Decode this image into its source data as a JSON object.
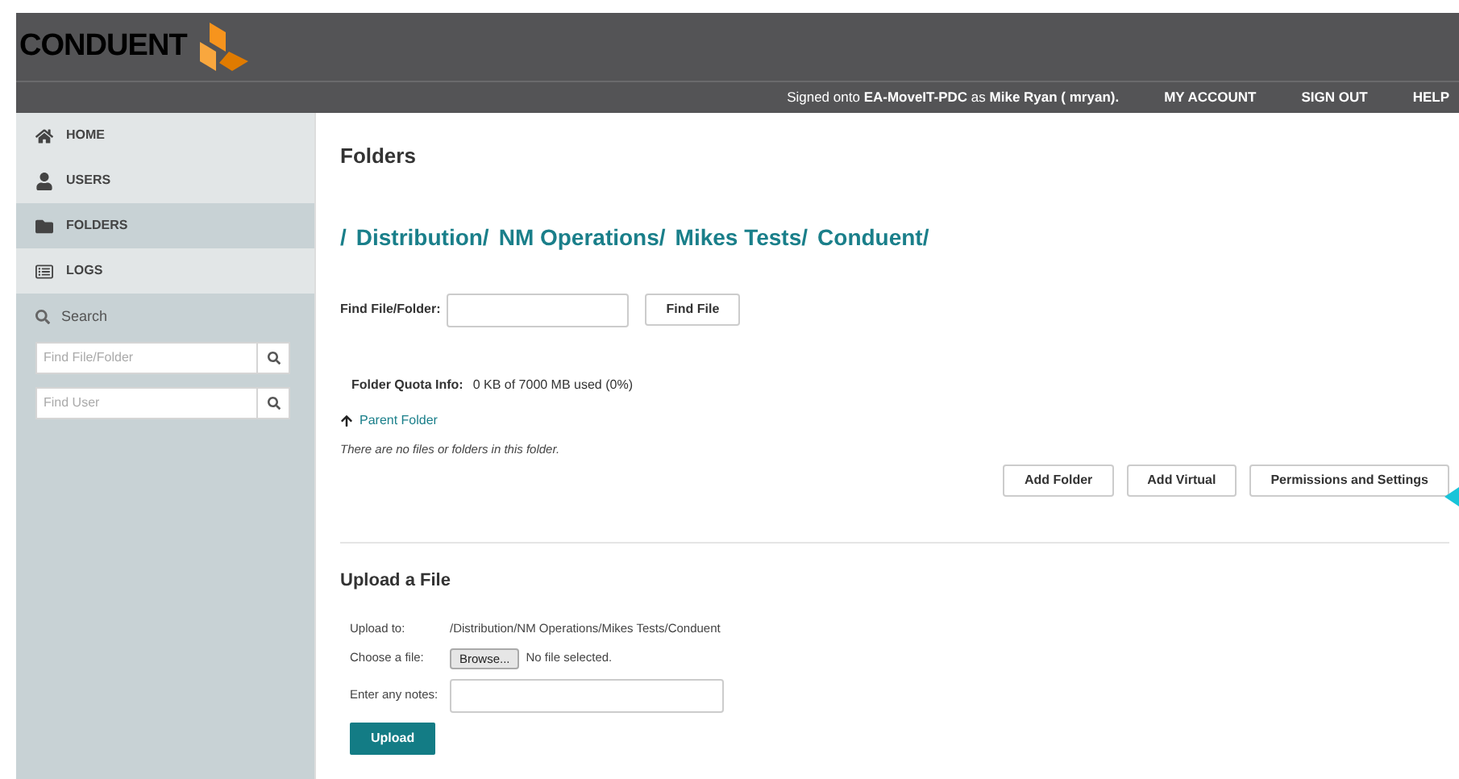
{
  "header": {
    "logo_text": "CONDUENT",
    "signed_in_prefix": "Signed onto",
    "server": "EA-MoveIT-PDC",
    "signed_in_middle": "as",
    "user": "Mike Ryan ( mryan).",
    "links": [
      "MY ACCOUNT",
      "SIGN OUT",
      "HELP"
    ]
  },
  "sidebar": {
    "items": [
      {
        "kind": "home",
        "label": "HOME",
        "selected": false
      },
      {
        "kind": "users",
        "label": "USERS",
        "selected": false
      },
      {
        "kind": "folders",
        "label": "FOLDERS",
        "selected": true
      },
      {
        "kind": "logs",
        "label": "LOGS",
        "selected": false
      }
    ],
    "search_label": "Search",
    "search_fields": [
      {
        "placeholder": "Find File/Folder"
      },
      {
        "placeholder": "Find User"
      }
    ]
  },
  "main": {
    "title": "Folders",
    "breadcrumb_lead": "/",
    "breadcrumb": [
      "Distribution/",
      "NM Operations/",
      "Mikes Tests/",
      "Conduent/"
    ],
    "find_label": "File/Folder:",
    "find_label_prefix": "Find",
    "find_button": "Find File",
    "quota_label": "Folder Quota Info:",
    "quota_value": "0 KB of 7000 MB used (0%)",
    "parent_link": "Parent Folder",
    "empty_message": "There are no files or folders in this folder.",
    "buttons": [
      "Add Folder",
      "Add Virtual",
      "Permissions and Settings"
    ]
  },
  "upload": {
    "title": "Upload a File",
    "upload_to_label": "Upload to:",
    "upload_to_value": "/Distribution/NM Operations/Mikes Tests/Conduent",
    "choose_label": "Choose a file:",
    "browse_button": "Browse...",
    "file_status": "No file selected.",
    "notes_label": "Enter any notes:",
    "upload_button": "Upload"
  }
}
